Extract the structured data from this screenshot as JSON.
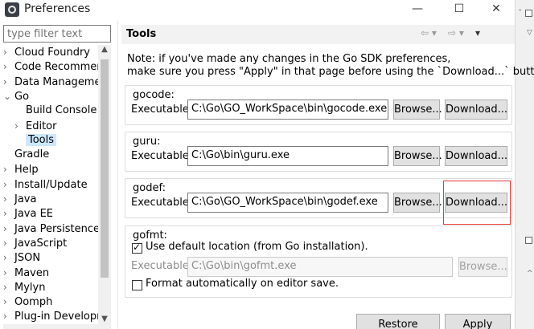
{
  "window": {
    "title": "Preferences",
    "minimize": "—",
    "maximize": "☐",
    "close": "✕"
  },
  "filter": {
    "placeholder": "type filter text"
  },
  "tree": [
    {
      "label": "Cloud Foundry",
      "chev": "›",
      "indent": 0,
      "selected": false
    },
    {
      "label": "Code Recommenders",
      "chev": "›",
      "indent": 0,
      "selected": false
    },
    {
      "label": "Data Management",
      "chev": "›",
      "indent": 0,
      "selected": false
    },
    {
      "label": "Go",
      "chev": "⌄",
      "indent": 0,
      "selected": false
    },
    {
      "label": "Build Console",
      "chev": "",
      "indent": 1,
      "selected": false
    },
    {
      "label": "Editor",
      "chev": "›",
      "indent": 1,
      "selected": false
    },
    {
      "label": "Tools",
      "chev": "",
      "indent": 1,
      "selected": true
    },
    {
      "label": "Gradle",
      "chev": "",
      "indent": 0,
      "selected": false
    },
    {
      "label": "Help",
      "chev": "›",
      "indent": 0,
      "selected": false
    },
    {
      "label": "Install/Update",
      "chev": "›",
      "indent": 0,
      "selected": false
    },
    {
      "label": "Java",
      "chev": "›",
      "indent": 0,
      "selected": false
    },
    {
      "label": "Java EE",
      "chev": "›",
      "indent": 0,
      "selected": false
    },
    {
      "label": "Java Persistence",
      "chev": "›",
      "indent": 0,
      "selected": false
    },
    {
      "label": "JavaScript",
      "chev": "›",
      "indent": 0,
      "selected": false
    },
    {
      "label": "JSON",
      "chev": "›",
      "indent": 0,
      "selected": false
    },
    {
      "label": "Maven",
      "chev": "›",
      "indent": 0,
      "selected": false
    },
    {
      "label": "Mylyn",
      "chev": "›",
      "indent": 0,
      "selected": false
    },
    {
      "label": "Oomph",
      "chev": "›",
      "indent": 0,
      "selected": false
    },
    {
      "label": "Plug-in Development",
      "chev": "›",
      "indent": 0,
      "selected": false
    }
  ],
  "page": {
    "title": "Tools",
    "note_line1": "Note: if you've made any changes in the Go SDK preferences,",
    "note_line2": "make sure you press \"Apply\" in that page before using the `Download...` button."
  },
  "labels": {
    "executable": "Executable:",
    "browse": "Browse...",
    "download": "Download..."
  },
  "gocode": {
    "title": "gocode:",
    "path": "C:\\Go\\GO_WorkSpace\\bin\\gocode.exe"
  },
  "guru": {
    "title": "guru:",
    "path": "C:\\Go\\bin\\guru.exe"
  },
  "godef": {
    "title": "godef:",
    "path": "C:\\Go\\GO_WorkSpace\\bin\\godef.exe"
  },
  "gofmt": {
    "title": "gofmt:",
    "use_default": "Use default location (from Go installation).",
    "use_default_checked": true,
    "path": "C:\\Go\\bin\\gofmt.exe",
    "format_on_save": "Format automatically on editor save.",
    "format_on_save_checked": false
  },
  "footer": {
    "restore": "Restore Defaults",
    "apply": "Apply"
  },
  "colors": {
    "selection": "#cce8ff",
    "highlight_box": "#e53935",
    "header_bg": "#f2f2f2"
  }
}
